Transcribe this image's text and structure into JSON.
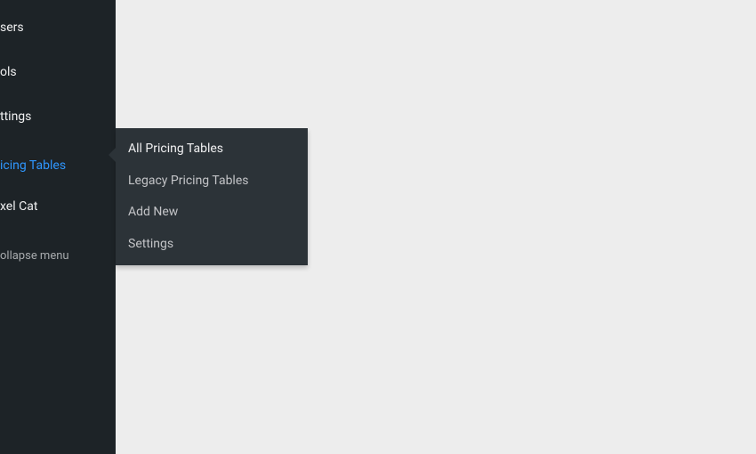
{
  "sidebar": {
    "items": [
      {
        "label": "sers"
      },
      {
        "label": "ols"
      },
      {
        "label": "ttings"
      },
      {
        "label": "icing Tables",
        "active": true
      },
      {
        "label": "xel Cat"
      }
    ],
    "collapse_label": "ollapse menu"
  },
  "flyout": {
    "items": [
      {
        "label": "All Pricing Tables"
      },
      {
        "label": "Legacy Pricing Tables"
      },
      {
        "label": "Add New"
      },
      {
        "label": "Settings"
      }
    ]
  }
}
